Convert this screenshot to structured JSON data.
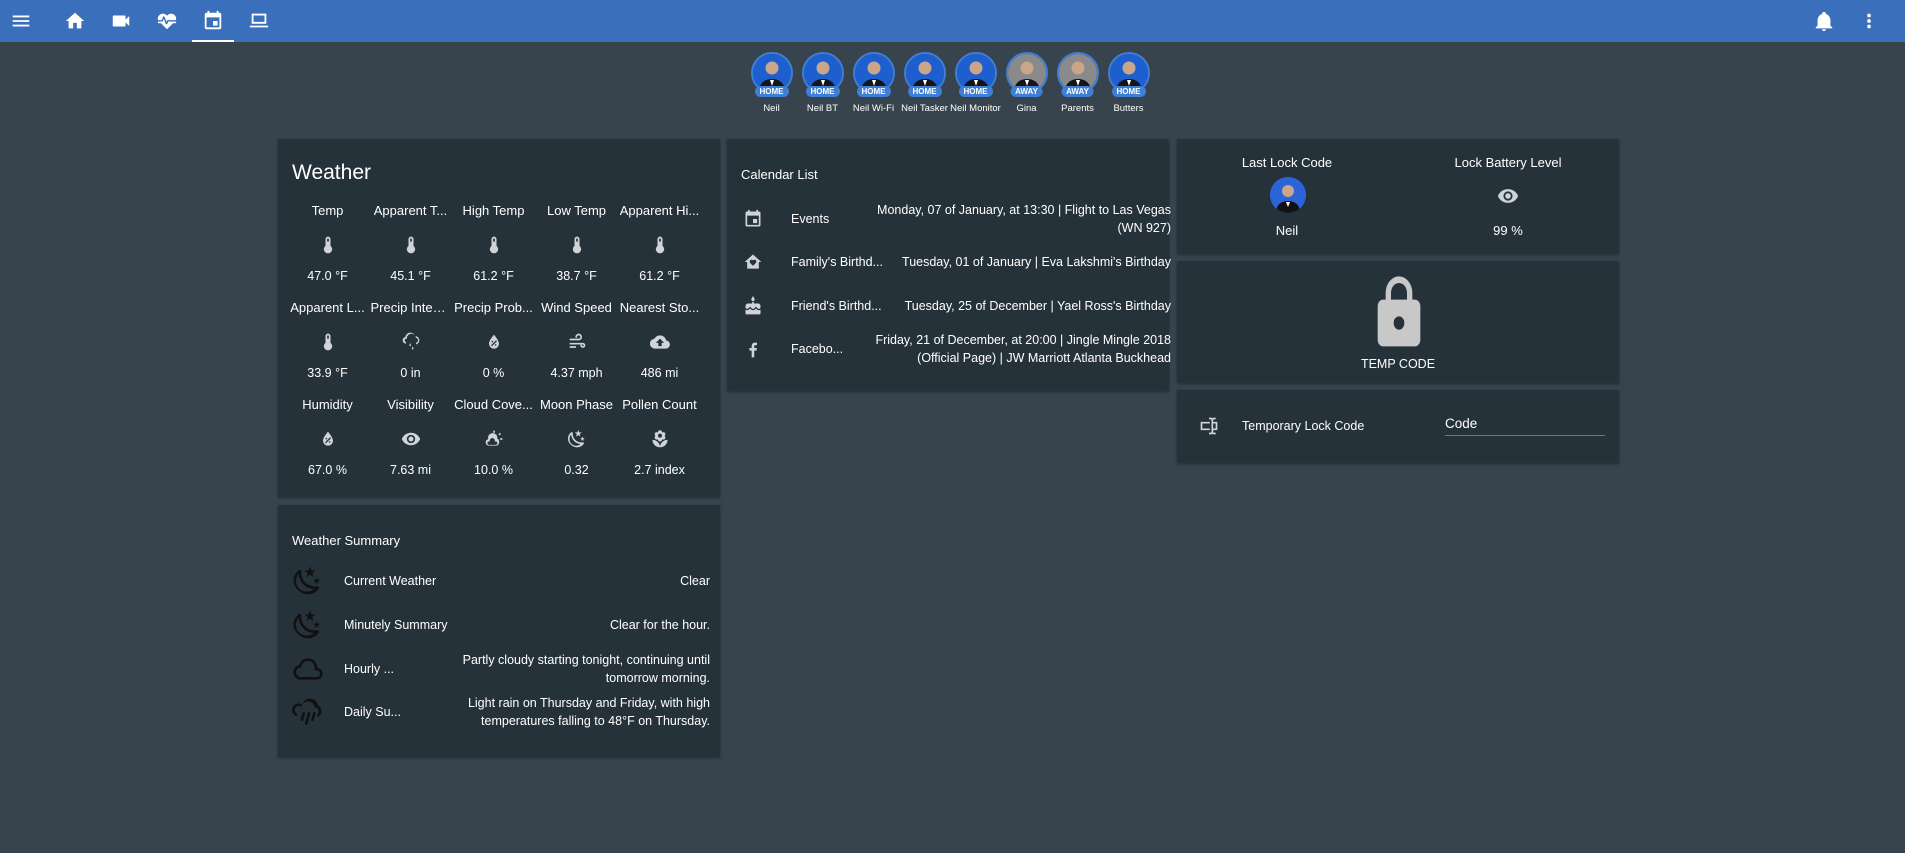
{
  "toolbar": {
    "icons": [
      "menu-icon",
      "home-icon",
      "camera-icon",
      "heart-pulse-icon",
      "calendar-icon",
      "laptop-icon",
      "bell-icon",
      "more-vert-icon"
    ],
    "accent": "#3a6fbb"
  },
  "badges": [
    {
      "name": "Neil",
      "state": "HOME"
    },
    {
      "name": "Neil BT",
      "state": "HOME"
    },
    {
      "name": "Neil Wi-Fi",
      "state": "HOME"
    },
    {
      "name": "Neil Tasker",
      "state": "HOME"
    },
    {
      "name": "Neil Monitor",
      "state": "HOME"
    },
    {
      "name": "Gina",
      "state": "AWAY"
    },
    {
      "name": "Parents",
      "state": "AWAY"
    },
    {
      "name": "Butters",
      "state": "HOME"
    }
  ],
  "weather": {
    "title": "Weather",
    "rows": [
      [
        {
          "label": "Temp",
          "icon": "thermometer-icon",
          "value": "47.0 °F"
        },
        {
          "label": "Apparent T...",
          "icon": "thermometer-icon",
          "value": "45.1 °F"
        },
        {
          "label": "High Temp",
          "icon": "thermometer-icon",
          "value": "61.2 °F"
        },
        {
          "label": "Low Temp",
          "icon": "thermometer-icon",
          "value": "38.7 °F"
        },
        {
          "label": "Apparent Hi...",
          "icon": "thermometer-icon",
          "value": "61.2 °F"
        }
      ],
      [
        {
          "label": "Apparent L...",
          "icon": "thermometer-icon",
          "value": "33.9 °F"
        },
        {
          "label": "Precip Inten...",
          "icon": "cloud-rain-icon",
          "value": "0 in"
        },
        {
          "label": "Precip Prob...",
          "icon": "water-percent-icon",
          "value": "0 %"
        },
        {
          "label": "Wind Speed",
          "icon": "wind-icon",
          "value": "4.37 mph"
        },
        {
          "label": "Nearest Sto...",
          "icon": "cloud-upload-icon",
          "value": "486 mi"
        }
      ],
      [
        {
          "label": "Humidity",
          "icon": "water-percent-icon",
          "value": "67.0 %"
        },
        {
          "label": "Visibility",
          "icon": "eye-icon",
          "value": "7.63 mi"
        },
        {
          "label": "Cloud Cove...",
          "icon": "partly-cloudy-icon",
          "value": "10.0 %"
        },
        {
          "label": "Moon Phase",
          "icon": "moon-stars-icon",
          "value": "0.32"
        },
        {
          "label": "Pollen Count",
          "icon": "flower-icon",
          "value": "2.7 index"
        }
      ]
    ]
  },
  "summary": {
    "title": "Weather Summary",
    "rows": [
      {
        "icon": "night-clear-icon",
        "label": "Current Weather",
        "value": "Clear"
      },
      {
        "icon": "night-clear-icon",
        "label": "Minutely Summary",
        "value": "Clear for the hour."
      },
      {
        "icon": "cloud-icon",
        "label": "Hourly ...",
        "value": "Partly cloudy starting tonight, continuing until\ntomorrow morning."
      },
      {
        "icon": "rain-icon",
        "label": "Daily Su...",
        "value": "Light rain on Thursday and Friday, with high\ntemperatures falling to 48°F on Thursday."
      }
    ]
  },
  "calendar": {
    "title": "Calendar List",
    "rows": [
      {
        "icon": "calendar-icon",
        "label": "Events",
        "value": "Monday, 07 of January, at 13:30 | Flight to Las Vegas\n(WN 927)"
      },
      {
        "icon": "home-heart-icon",
        "label": "Family's Birthd...",
        "value": "Tuesday, 01 of January | Eva Lakshmi's Birthday"
      },
      {
        "icon": "cake-icon",
        "label": "Friend's Birthd...",
        "value": "Tuesday, 25 of December | Yael Ross's Birthday"
      },
      {
        "icon": "facebook-icon",
        "label": "Facebo...",
        "value": "Friday, 21 of December, at 20:00 | Jingle Mingle 2018\n(Official Page) | JW Marriott Atlanta Buckhead"
      }
    ]
  },
  "lock": {
    "last_code_label": "Last Lock Code",
    "last_code_value": "Neil",
    "battery_label": "Lock Battery Level",
    "battery_value": "99 %",
    "temp_code_label": "TEMP CODE",
    "temp_lock_label": "Temporary Lock Code",
    "temp_lock_input_value": "Code"
  }
}
